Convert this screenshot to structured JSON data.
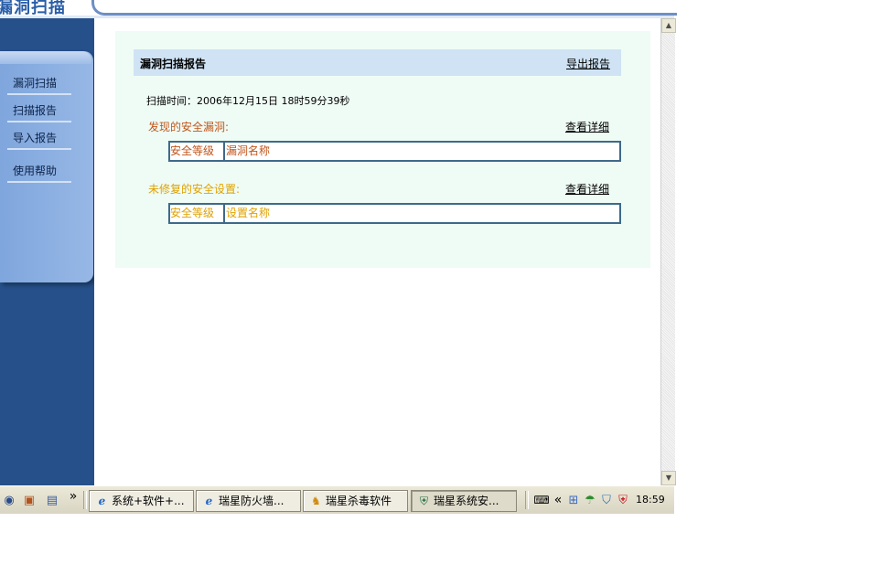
{
  "header": {
    "title": "漏洞扫描"
  },
  "sidebar": {
    "items": [
      {
        "label": "漏洞扫描"
      },
      {
        "label": "扫描报告"
      },
      {
        "label": "导入报告"
      },
      {
        "label": "使用帮助"
      }
    ]
  },
  "report": {
    "title": "漏洞扫描报告",
    "export_label": "导出报告",
    "scan_time": "扫描时间：2006年12月15日 18时59分39秒",
    "vulnerabilities": {
      "label": "发现的安全漏洞:",
      "detail_link": "查看详细",
      "columns": [
        "安全等级",
        "漏洞名称"
      ],
      "color": "#c0561b"
    },
    "unfixed_settings": {
      "label": "未修复的安全设置:",
      "detail_link": "查看详细",
      "columns": [
        "安全等级",
        "设置名称"
      ],
      "color": "#e0a200"
    }
  },
  "scrollbar": {
    "up_glyph": "▲",
    "down_glyph": "▼"
  },
  "taskbar": {
    "quicklaunch": [
      {
        "icon": "media-player-icon",
        "glyph": "◉"
      },
      {
        "icon": "desktop-icon",
        "glyph": "▣"
      },
      {
        "icon": "show-desktop-icon",
        "glyph": "▤"
      }
    ],
    "more_glyph": "»",
    "tasks": [
      {
        "label": "系统+软件+...",
        "icon": "ie-icon",
        "glyph": "ℯ"
      },
      {
        "label": "瑞星防火墙...",
        "icon": "ie-icon",
        "glyph": "ℯ"
      },
      {
        "label": "瑞星杀毒软件",
        "icon": "lion-icon",
        "glyph": "♞"
      },
      {
        "label": "瑞星系统安...",
        "icon": "shield-icon",
        "glyph": "⛨"
      }
    ],
    "tray_collapse_glyph": "«",
    "clock": "18:59"
  }
}
